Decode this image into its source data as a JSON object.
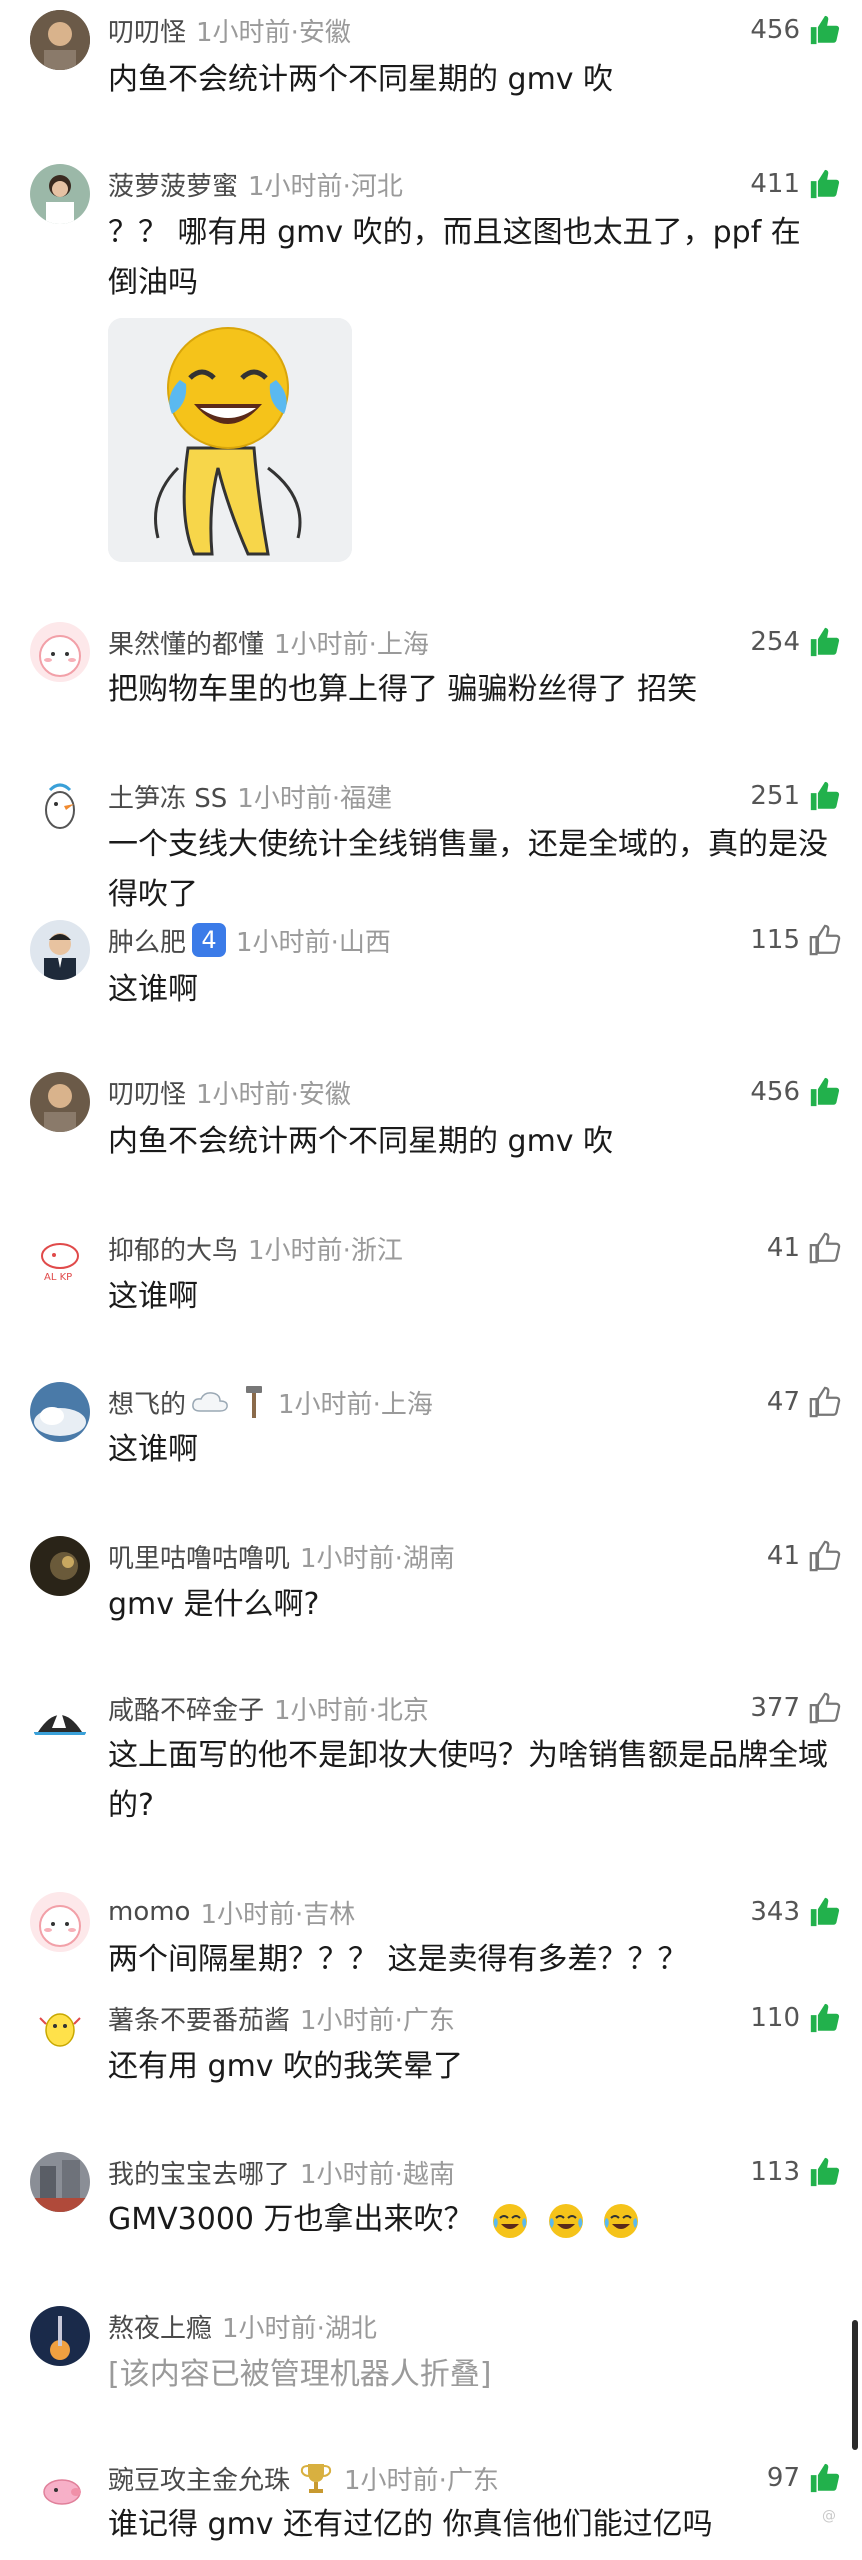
{
  "colors": {
    "like_active": "#22b14c",
    "like_inactive": "#777777",
    "meta": "#9a9a9a",
    "badge": "#3b7be8"
  },
  "comments": [
    {
      "user": "叨叨怪",
      "time": "1小时前",
      "loc": "安徽",
      "likes": "456",
      "liked": true,
      "text": "内鱼不会统计两个不同星期的 gmv 吹"
    },
    {
      "user": "菠萝菠萝蜜",
      "time": "1小时前",
      "loc": "河北",
      "likes": "411",
      "liked": true,
      "text": "？？ 哪有用 gmv 吹的，而且这图也太丑了，ppf 在倒油吗",
      "image": "laughing-crying-emoji-sticker"
    },
    {
      "user": "果然懂的都懂",
      "time": "1小时前",
      "loc": "上海",
      "likes": "254",
      "liked": true,
      "text": "把购物车里的也算上得了 骗骗粉丝得了 招笑"
    },
    {
      "user": "土笋冻 SS",
      "time": "1小时前",
      "loc": "福建",
      "likes": "251",
      "liked": true,
      "text": "一个支线大使统计全线销售量，还是全域的，真的是没得吹了"
    },
    {
      "user": "肿么肥",
      "badge": "4",
      "time": "1小时前",
      "loc": "山西",
      "likes": "115",
      "liked": false,
      "text": "这谁啊"
    },
    {
      "user": "叨叨怪",
      "time": "1小时前",
      "loc": "安徽",
      "likes": "456",
      "liked": true,
      "text": "内鱼不会统计两个不同星期的 gmv 吹"
    },
    {
      "user": "抑郁的大鸟",
      "time": "1小时前",
      "loc": "浙江",
      "likes": "41",
      "liked": false,
      "text": "这谁啊"
    },
    {
      "user": "想飞的",
      "time": "1小时前",
      "loc": "上海",
      "likes": "47",
      "liked": false,
      "text": "这谁啊"
    },
    {
      "user": "叽里咕噜咕噜叽",
      "time": "1小时前",
      "loc": "湖南",
      "likes": "41",
      "liked": false,
      "text": "gmv 是什么啊?"
    },
    {
      "user": "咸酪不碎金子",
      "time": "1小时前",
      "loc": "北京",
      "likes": "377",
      "liked": false,
      "text": "这上面写的他不是卸妆大使吗？为啥销售额是品牌全域的?"
    },
    {
      "user": "momo",
      "time": "1小时前",
      "loc": "吉林",
      "likes": "343",
      "liked": true,
      "text": "两个间隔星期？？？ 这是卖得有多差？？？"
    },
    {
      "user": "薯条不要番茄酱",
      "time": "1小时前",
      "loc": "广东",
      "likes": "110",
      "liked": true,
      "text": "还有用 gmv 吹的我笑晕了"
    },
    {
      "user": "我的宝宝去哪了",
      "time": "1小时前",
      "loc": "越南",
      "likes": "113",
      "liked": true,
      "text": "GMV3000 万也拿出来吹？"
    },
    {
      "user": "熬夜上瘾",
      "time": "1小时前",
      "loc": "湖北",
      "likes": "",
      "liked": false,
      "text": "[该内容已被管理机器人折叠]",
      "folded": true
    },
    {
      "user": "豌豆攻主金允珠",
      "time": "1小时前",
      "loc": "广东",
      "likes": "97",
      "liked": true,
      "text": "谁记得 gmv 还有过亿的 你真信他们能过亿吗"
    }
  ],
  "separator": "·",
  "watermark": "@"
}
